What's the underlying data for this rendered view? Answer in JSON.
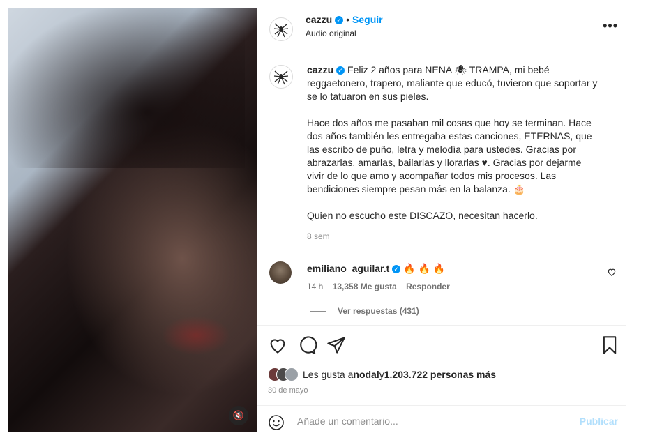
{
  "header": {
    "username": "cazzu",
    "separator": "•",
    "follow_label": "Seguir",
    "audio_label": "Audio original",
    "more_label": "•••"
  },
  "caption": {
    "username": "cazzu",
    "text": "Feliz 2 años para NENA 🕷 TRAMPA, mi bebé reggaetonero, trapero, maliante que educó, tuvieron que soportar y se lo tatuaron en sus pieles.\n\nHace dos años me pasaban mil cosas que hoy se terminan. Hace dos años también les entregaba estas canciones, ETERNAS, que las escribo de puño, letra y melodía para ustedes. Gracias por abrazarlas, amarlas, bailarlas y llorarlas ♥. Gracias por dejarme vivir de lo que amo y acompañar todos mis procesos. Las bendiciones siempre pesan más en la balanza. 🎂\n\nQuien no escucho este DISCAZO, necesitan hacerlo.",
    "time": "8 sem"
  },
  "comment": {
    "username": "emiliano_aguilar.t",
    "text": "🔥 🔥 🔥",
    "time": "14 h",
    "likes": "13,358 Me gusta",
    "reply_label": "Responder",
    "view_replies": "Ver respuestas (431)"
  },
  "likes": {
    "prefix": "Les gusta a ",
    "user": "nodal",
    "middle": " y ",
    "count": "1.203.722 personas más"
  },
  "date": "30 de mayo",
  "add_comment": {
    "placeholder": "Añade un comentario...",
    "publish_label": "Publicar"
  },
  "icons": {
    "verified": "✓",
    "mute": "🔇"
  },
  "colors": {
    "accent": "#0095f6",
    "publish_disabled": "#b2dffc",
    "muted_text": "#8e8e8e"
  }
}
